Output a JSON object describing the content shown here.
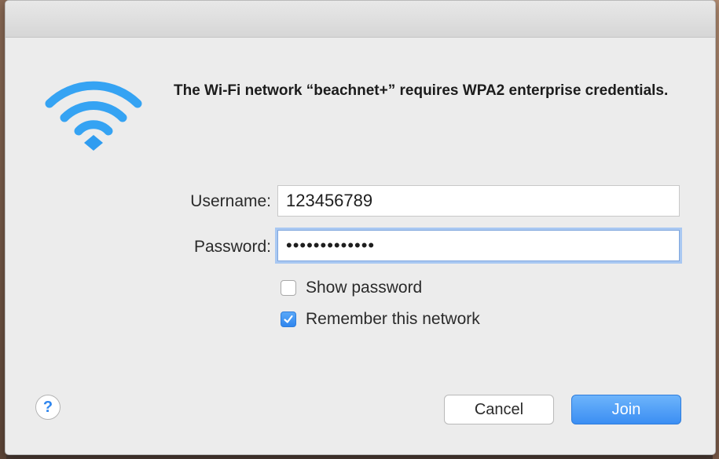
{
  "dialog": {
    "message": "The Wi-Fi network “beachnet+” requires WPA2 enterprise credentials."
  },
  "form": {
    "username_label": "Username:",
    "username_value": "123456789",
    "password_label": "Password:",
    "password_masked": "•••••••••••••"
  },
  "options": {
    "show_password_label": "Show password",
    "show_password_checked": false,
    "remember_label": "Remember this network",
    "remember_checked": true
  },
  "buttons": {
    "help_label": "?",
    "cancel_label": "Cancel",
    "join_label": "Join"
  },
  "colors": {
    "accent": "#3b8ef3",
    "wifi_icon": "#2f9cf0"
  }
}
